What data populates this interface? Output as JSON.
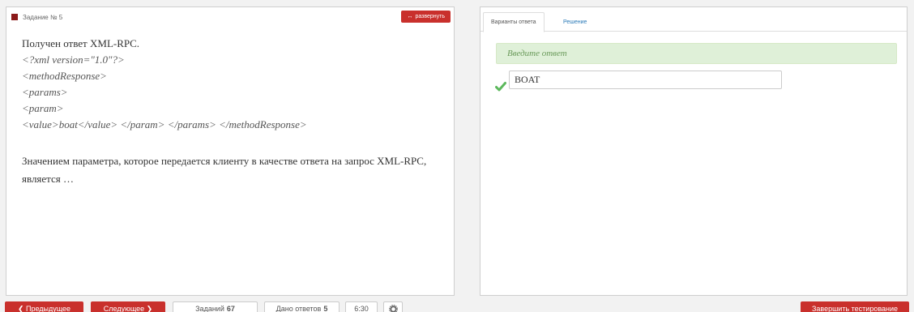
{
  "task": {
    "title": "Задание № 5",
    "expand_label": "развернуть",
    "lines": {
      "l1": "Получен ответ XML-RPC.",
      "l2": "<?xml version=\"1.0\"?>",
      "l3": "<methodResponse>",
      "l4": "<params>",
      "l5": "<param>",
      "l6": "<value>boat</value> </param> </params> </methodResponse>"
    },
    "question": "Значением параметра, которое передается клиенту в качестве ответа на запрос XML-RPC, является …"
  },
  "answer": {
    "tab_options": "Варианты ответа",
    "tab_solution": "Решение",
    "prompt": "Введите ответ",
    "value": "BOAT"
  },
  "footer": {
    "prev_label": "Предыдущее",
    "next_label": "Следующее",
    "tasks_label": "Заданий",
    "tasks_count": "67",
    "answered_label": "Дано ответов",
    "answered_count": "5",
    "timer": "6:30",
    "finish_label": "Завершить тестирование"
  },
  "colors": {
    "accent": "#c9302c",
    "success_bg": "#dff0d8",
    "link": "#2a7ab8"
  },
  "icons": {
    "check": "check-icon",
    "settings": "gear-icon",
    "prev": "chevron-left-icon",
    "next": "chevron-right-icon",
    "expand": "expand-arrows-icon"
  }
}
